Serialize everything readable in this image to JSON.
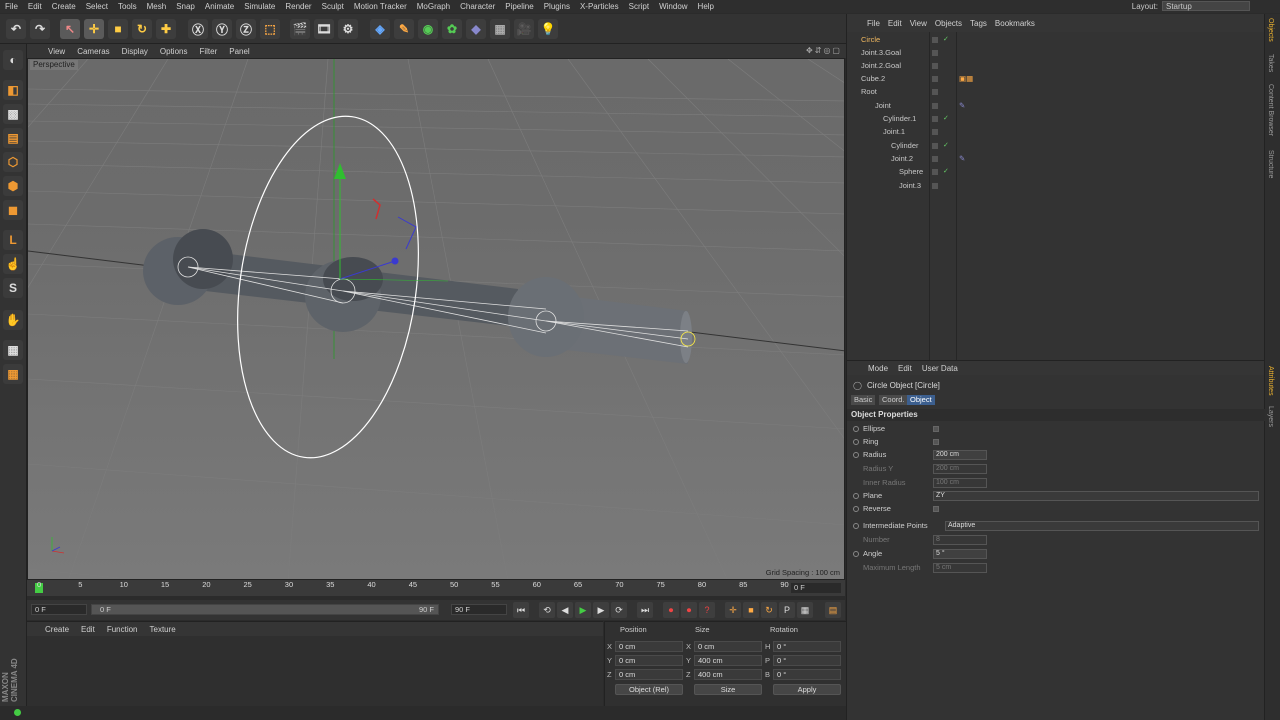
{
  "menubar": [
    "File",
    "Edit",
    "Create",
    "Select",
    "Tools",
    "Mesh",
    "Snap",
    "Animate",
    "Simulate",
    "Render",
    "Sculpt",
    "Motion Tracker",
    "MoGraph",
    "Character",
    "Pipeline",
    "Plugins",
    "X-Particles",
    "Script",
    "Window",
    "Help"
  ],
  "layout": {
    "label": "Layout:",
    "value": "Startup"
  },
  "viewport": {
    "menu": [
      "View",
      "Cameras",
      "Display",
      "Options",
      "Filter",
      "Panel"
    ],
    "label": "Perspective",
    "grid_spacing": "Grid Spacing : 100 cm"
  },
  "timeline": {
    "ticks": [
      "0",
      "5",
      "10",
      "15",
      "20",
      "25",
      "30",
      "35",
      "40",
      "45",
      "50",
      "55",
      "60",
      "65",
      "70",
      "75",
      "80",
      "85",
      "90"
    ],
    "current_frame": "0 F"
  },
  "transport": {
    "start": "0 F",
    "range_start": "0 F",
    "range_end": "90 F",
    "end": "90 F"
  },
  "material": {
    "menu": [
      "Create",
      "Edit",
      "Function",
      "Texture"
    ]
  },
  "coords": {
    "headers": {
      "position": "Position",
      "size": "Size",
      "rotation": "Rotation"
    },
    "rows": [
      {
        "axis": "X",
        "pos": "0 cm",
        "saxis": "X",
        "size": "0 cm",
        "raxis": "H",
        "rot": "0 °"
      },
      {
        "axis": "Y",
        "pos": "0 cm",
        "saxis": "Y",
        "size": "400 cm",
        "raxis": "P",
        "rot": "0 °"
      },
      {
        "axis": "Z",
        "pos": "0 cm",
        "saxis": "Z",
        "size": "400 cm",
        "raxis": "B",
        "rot": "0 °"
      }
    ],
    "mode": "Object (Rel)",
    "size_mode": "Size",
    "apply": "Apply"
  },
  "objects": {
    "menu": [
      "File",
      "Edit",
      "View",
      "Objects",
      "Tags",
      "Bookmarks"
    ],
    "items": [
      {
        "name": "Circle",
        "selected": true
      },
      {
        "name": "Joint.3.Goal"
      },
      {
        "name": "Joint.2.Goal"
      },
      {
        "name": "Cube.2"
      },
      {
        "name": "Root"
      },
      {
        "name": "Joint"
      },
      {
        "name": "Cylinder.1"
      },
      {
        "name": "Joint.1"
      },
      {
        "name": "Cylinder"
      },
      {
        "name": "Joint.2"
      },
      {
        "name": "Sphere"
      },
      {
        "name": "Joint.3"
      }
    ]
  },
  "sidetabs": [
    "Objects",
    "Takes",
    "Content Browser",
    "Structure",
    "Attributes",
    "Layers"
  ],
  "attributes": {
    "menu": [
      "Mode",
      "Edit",
      "User Data"
    ],
    "title": "Circle Object [Circle]",
    "tabs": [
      "Basic",
      "Coord.",
      "Object"
    ],
    "section": "Object Properties",
    "rows": [
      {
        "label": "Ellipse",
        "type": "check"
      },
      {
        "label": "Ring",
        "type": "check"
      },
      {
        "label": "Radius",
        "value": "200 cm"
      },
      {
        "label": "Radius Y",
        "value": "200 cm",
        "disabled": true
      },
      {
        "label": "Inner Radius",
        "value": "100 cm",
        "disabled": true
      },
      {
        "label": "Plane",
        "value": "ZY",
        "wide": true
      },
      {
        "label": "Reverse",
        "type": "check"
      },
      {
        "label": "Intermediate Points",
        "value": "Adaptive",
        "wide": true
      },
      {
        "label": "Number",
        "value": "8",
        "disabled": true
      },
      {
        "label": "Angle",
        "value": "5 °"
      },
      {
        "label": "Maximum Length",
        "value": "5 cm",
        "disabled": true
      }
    ]
  },
  "brand": "MAXON CINEMA 4D"
}
